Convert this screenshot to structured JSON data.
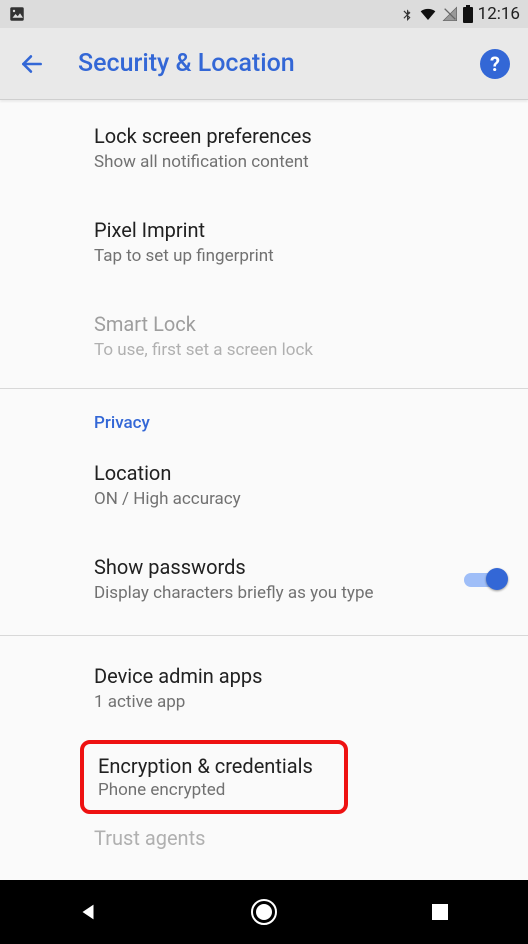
{
  "statusbar": {
    "time": "12:16"
  },
  "appbar": {
    "title": "Security & Location",
    "help": "?"
  },
  "items": [
    {
      "title": "Lock screen preferences",
      "sub": "Show all notification content"
    },
    {
      "title": "Pixel Imprint",
      "sub": "Tap to set up fingerprint"
    },
    {
      "title": "Smart Lock",
      "sub": "To use, first set a screen lock"
    }
  ],
  "section": "Privacy",
  "privacy": [
    {
      "title": "Location",
      "sub": "ON / High accuracy"
    },
    {
      "title": "Show passwords",
      "sub": "Display characters briefly as you type"
    }
  ],
  "more": [
    {
      "title": "Device admin apps",
      "sub": "1 active app"
    }
  ],
  "highlight": {
    "title": "Encryption & credentials",
    "sub": "Phone encrypted"
  },
  "truncated": "Trust agents"
}
